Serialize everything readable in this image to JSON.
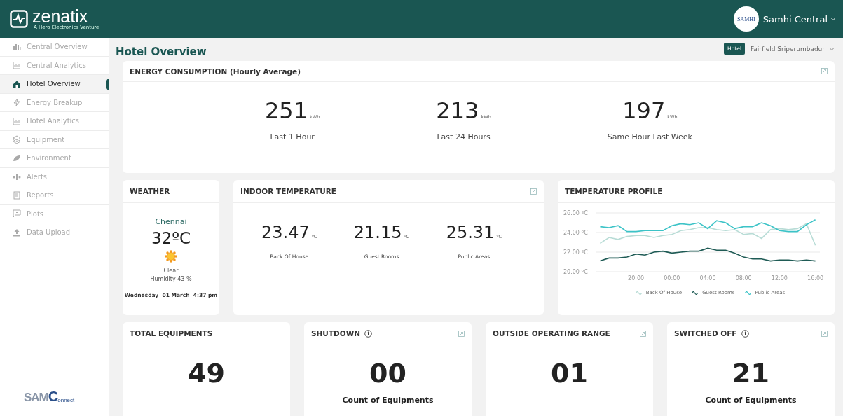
{
  "header": {
    "logo": {
      "name": "zenatix",
      "tagline": "A Hero Electronics Venture"
    },
    "user": {
      "avatar_text": "SAMHI",
      "name": "Samhi Central"
    }
  },
  "sidebar": {
    "items": [
      {
        "label": "Central Overview",
        "kind": "buildings",
        "selected": false
      },
      {
        "label": "Central Analytics",
        "kind": "bars",
        "selected": false
      },
      {
        "label": "Hotel Overview",
        "kind": "hotel",
        "selected": true
      },
      {
        "label": "Energy Breakup",
        "kind": "bolt",
        "selected": false
      },
      {
        "label": "Hotel Analytics",
        "kind": "bars",
        "selected": false
      },
      {
        "label": "Equipment",
        "kind": "layers",
        "selected": false
      },
      {
        "label": "Environment",
        "kind": "leaf",
        "selected": false
      },
      {
        "label": "Alerts",
        "kind": "alerts",
        "selected": false
      },
      {
        "label": "Reports",
        "kind": "report",
        "selected": false
      },
      {
        "label": "Plots",
        "kind": "plot",
        "selected": false
      },
      {
        "label": "Data Upload",
        "kind": "upload",
        "selected": false
      }
    ],
    "footer_logo": {
      "part_1": "SAM",
      "part_2": "C",
      "part_3": "onnect"
    }
  },
  "page": {
    "title": "Hotel Overview",
    "filter": {
      "tag": "Hotel",
      "value": "Fairfield Sriperumbadur"
    }
  },
  "energy": {
    "title": "ENERGY CONSUMPTION (Hourly Average)",
    "stats": [
      {
        "value": "251",
        "unit": "kWh",
        "label": "Last 1 Hour"
      },
      {
        "value": "213",
        "unit": "kWh",
        "label": "Last 24 Hours"
      },
      {
        "value": "197",
        "unit": "kWh",
        "label": "Same Hour Last Week"
      }
    ]
  },
  "weather": {
    "title": "WEATHER",
    "city": "Chennai",
    "temperature": "32ºC",
    "condition": "Clear",
    "humidity": "Humidity 43 %",
    "date": "Wednesday  01 March  4:37 pm"
  },
  "indoor": {
    "title": "INDOOR TEMPERATURE",
    "stats": [
      {
        "value": "23.47",
        "unit": "ºC",
        "label": "Back Of House"
      },
      {
        "value": "21.15",
        "unit": "ºC",
        "label": "Guest Rooms"
      },
      {
        "value": "25.31",
        "unit": "ºC",
        "label": "Public Areas"
      }
    ]
  },
  "temperature_profile": {
    "title": "TEMPERATURE PROFILE",
    "chart_data": {
      "type": "line",
      "categories": [
        null,
        null,
        null,
        null,
        "20:00",
        null,
        null,
        null,
        "00:00",
        null,
        null,
        null,
        "04:00",
        null,
        null,
        null,
        "08:00",
        null,
        null,
        null,
        "12:00",
        null,
        null,
        null,
        "16:00"
      ],
      "ylim": [
        20,
        26
      ],
      "yticks": [
        {
          "value": 20,
          "label": "20.00 ºC"
        },
        {
          "value": 22,
          "label": "22.00 ºC"
        },
        {
          "value": 24,
          "label": "24.00 ºC"
        },
        {
          "value": 26,
          "label": "26.00 ºC"
        }
      ],
      "series": [
        {
          "name": "Back Of House",
          "color": "#b8dcd6",
          "values": [
            22.9,
            23.5,
            23.3,
            23.6,
            23.7,
            23.7,
            23.5,
            23.7,
            23.8,
            24.2,
            24.3,
            24.5,
            24.5,
            24.3,
            24.2,
            24.3,
            23.8,
            23.9,
            23.4,
            24.3,
            24.4,
            24.3,
            24.4,
            24.9,
            22.7
          ]
        },
        {
          "name": "Guest Rooms",
          "color": "#1f5b55",
          "values": [
            21.1,
            21.4,
            21.4,
            21.5,
            21.8,
            21.7,
            22.0,
            22.1,
            21.9,
            22.0,
            22.1,
            22.1,
            22.4,
            22.2,
            22.2,
            21.9,
            21.5,
            21.3,
            21.3,
            21.1,
            21.2,
            21.2,
            21.1,
            21.2,
            21.1
          ]
        },
        {
          "name": "Public Areas",
          "color": "#3cc3c7",
          "values": [
            24.6,
            24.5,
            24.7,
            24.1,
            24.1,
            24.2,
            24.2,
            24.2,
            24.7,
            24.9,
            24.8,
            25.0,
            24.4,
            25.2,
            25.0,
            24.4,
            24.6,
            24.6,
            25.0,
            24.7,
            24.2,
            24.1,
            24.1,
            24.8,
            25.3
          ]
        }
      ]
    }
  },
  "equipment_cards": [
    {
      "title": "TOTAL EQUIPMENTS",
      "info": false,
      "expand": false,
      "value": "49"
    },
    {
      "title": "SHUTDOWN",
      "info": true,
      "expand": true,
      "value": "00",
      "caption": "Count of Equipments"
    },
    {
      "title": "OUTSIDE OPERATING RANGE",
      "info": false,
      "expand": true,
      "value": "01"
    },
    {
      "title": "SWITCHED OFF",
      "info": true,
      "expand": true,
      "value": "21",
      "caption": "Count of Equipments"
    }
  ]
}
